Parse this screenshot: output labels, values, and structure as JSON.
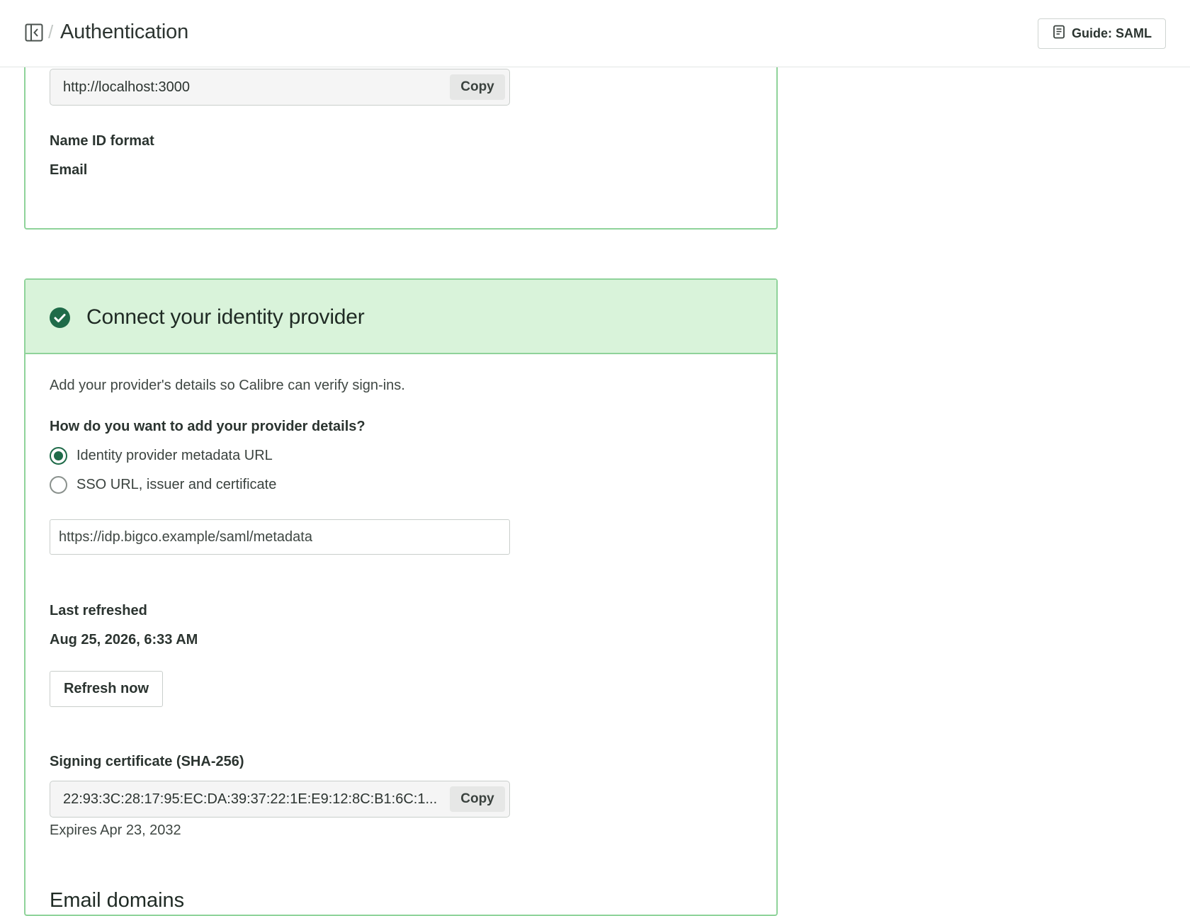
{
  "header": {
    "breadcrumb_separator": "/",
    "title": "Authentication",
    "guide_button_label": "Guide: SAML",
    "sidebar_toggle_icon": "sidebar-collapse-icon",
    "guide_icon": "document-icon"
  },
  "service_provider": {
    "entity_value": "http://localhost:3000",
    "copy_label": "Copy",
    "name_id_label": "Name ID format",
    "name_id_value": "Email"
  },
  "identity_provider": {
    "title": "Connect your identity provider",
    "status_icon": "check-circle-icon",
    "description": "Add your provider's details so Calibre can verify sign-ins.",
    "question": "How do you want to add your provider details?",
    "options": [
      {
        "label": "Identity provider metadata URL",
        "selected": true
      },
      {
        "label": "SSO URL, issuer and certificate",
        "selected": false
      }
    ],
    "metadata_url": "https://idp.bigco.example/saml/metadata",
    "last_refreshed_label": "Last refreshed",
    "last_refreshed_value": "Aug 25, 2026, 6:33 AM",
    "refresh_button": "Refresh now",
    "certificate_label": "Signing certificate (SHA-256)",
    "certificate_value": "22:93:3C:28:17:95:EC:DA:39:37:22:1E:E9:12:8C:B1:6C:1...",
    "certificate_copy_label": "Copy",
    "expires_text": "Expires Apr 23, 2032"
  },
  "email_domains": {
    "heading": "Email domains"
  },
  "colors": {
    "accent_green": "#1f6b49",
    "card_border": "#8fd39a",
    "card_header_bg": "#d9f3da"
  }
}
